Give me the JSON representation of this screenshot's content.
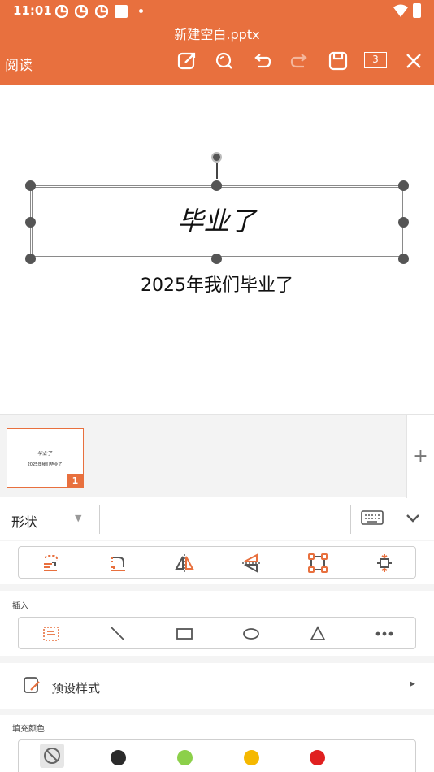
{
  "status_bar": {
    "time": "11:01"
  },
  "header": {
    "doc_title": "新建空白.pptx",
    "read_mode_label": "阅读",
    "slide_count": "3",
    "accent_color": "#e8703e",
    "icons": [
      "edit-icon",
      "search-icon",
      "undo-icon",
      "redo-icon",
      "save-icon",
      "close-icon"
    ]
  },
  "slide": {
    "title": "毕业了",
    "subtitle": "2025年我们毕业了"
  },
  "thumbnails": {
    "items": [
      {
        "number": "1",
        "title": "毕业了",
        "subtitle": "2025年我们毕业了"
      }
    ],
    "add_label": "+"
  },
  "panel": {
    "tab_label": "形状",
    "arrange_icons": [
      "bring-forward-icon",
      "send-backward-icon",
      "flip-horizontal-icon",
      "flip-vertical-icon",
      "resize-icon",
      "fit-icon"
    ],
    "insert_label": "插入",
    "insert_icons": [
      "textbox-icon",
      "line-icon",
      "rectangle-icon",
      "ellipse-icon",
      "triangle-icon",
      "more-icon"
    ],
    "preset_label": "预设样式",
    "fill_label": "填充颜色",
    "fill_colors": [
      "#2b2b2b",
      "#8cd04a",
      "#f5b800",
      "#e02020"
    ]
  }
}
